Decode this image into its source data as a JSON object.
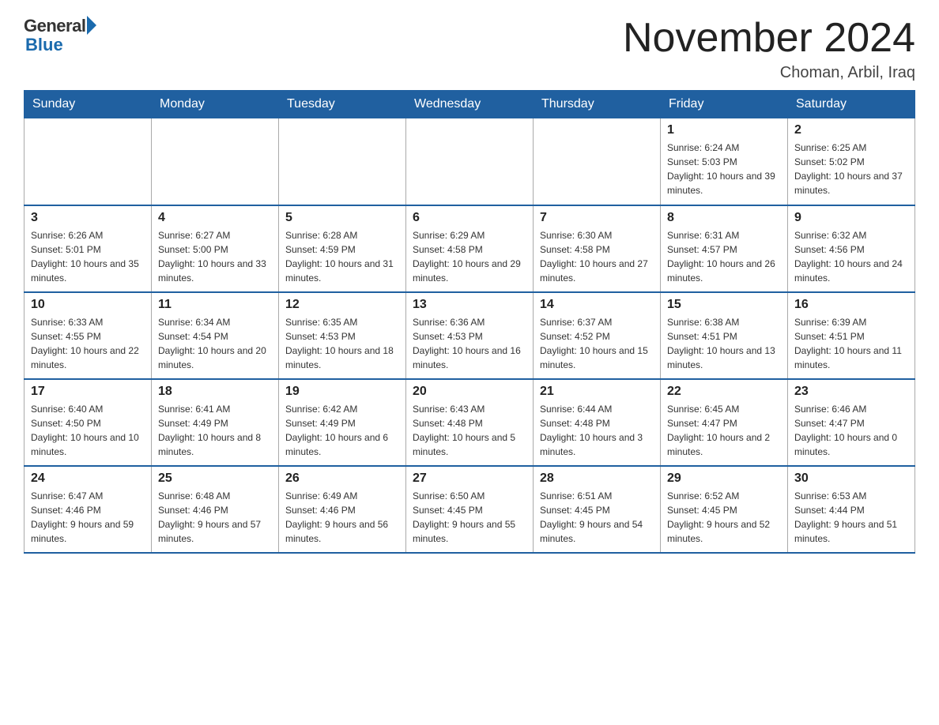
{
  "logo": {
    "general": "General",
    "blue": "Blue"
  },
  "title": {
    "month": "November 2024",
    "location": "Choman, Arbil, Iraq"
  },
  "days_of_week": [
    "Sunday",
    "Monday",
    "Tuesday",
    "Wednesday",
    "Thursday",
    "Friday",
    "Saturday"
  ],
  "weeks": [
    [
      {
        "day": "",
        "info": ""
      },
      {
        "day": "",
        "info": ""
      },
      {
        "day": "",
        "info": ""
      },
      {
        "day": "",
        "info": ""
      },
      {
        "day": "",
        "info": ""
      },
      {
        "day": "1",
        "info": "Sunrise: 6:24 AM\nSunset: 5:03 PM\nDaylight: 10 hours and 39 minutes."
      },
      {
        "day": "2",
        "info": "Sunrise: 6:25 AM\nSunset: 5:02 PM\nDaylight: 10 hours and 37 minutes."
      }
    ],
    [
      {
        "day": "3",
        "info": "Sunrise: 6:26 AM\nSunset: 5:01 PM\nDaylight: 10 hours and 35 minutes."
      },
      {
        "day": "4",
        "info": "Sunrise: 6:27 AM\nSunset: 5:00 PM\nDaylight: 10 hours and 33 minutes."
      },
      {
        "day": "5",
        "info": "Sunrise: 6:28 AM\nSunset: 4:59 PM\nDaylight: 10 hours and 31 minutes."
      },
      {
        "day": "6",
        "info": "Sunrise: 6:29 AM\nSunset: 4:58 PM\nDaylight: 10 hours and 29 minutes."
      },
      {
        "day": "7",
        "info": "Sunrise: 6:30 AM\nSunset: 4:58 PM\nDaylight: 10 hours and 27 minutes."
      },
      {
        "day": "8",
        "info": "Sunrise: 6:31 AM\nSunset: 4:57 PM\nDaylight: 10 hours and 26 minutes."
      },
      {
        "day": "9",
        "info": "Sunrise: 6:32 AM\nSunset: 4:56 PM\nDaylight: 10 hours and 24 minutes."
      }
    ],
    [
      {
        "day": "10",
        "info": "Sunrise: 6:33 AM\nSunset: 4:55 PM\nDaylight: 10 hours and 22 minutes."
      },
      {
        "day": "11",
        "info": "Sunrise: 6:34 AM\nSunset: 4:54 PM\nDaylight: 10 hours and 20 minutes."
      },
      {
        "day": "12",
        "info": "Sunrise: 6:35 AM\nSunset: 4:53 PM\nDaylight: 10 hours and 18 minutes."
      },
      {
        "day": "13",
        "info": "Sunrise: 6:36 AM\nSunset: 4:53 PM\nDaylight: 10 hours and 16 minutes."
      },
      {
        "day": "14",
        "info": "Sunrise: 6:37 AM\nSunset: 4:52 PM\nDaylight: 10 hours and 15 minutes."
      },
      {
        "day": "15",
        "info": "Sunrise: 6:38 AM\nSunset: 4:51 PM\nDaylight: 10 hours and 13 minutes."
      },
      {
        "day": "16",
        "info": "Sunrise: 6:39 AM\nSunset: 4:51 PM\nDaylight: 10 hours and 11 minutes."
      }
    ],
    [
      {
        "day": "17",
        "info": "Sunrise: 6:40 AM\nSunset: 4:50 PM\nDaylight: 10 hours and 10 minutes."
      },
      {
        "day": "18",
        "info": "Sunrise: 6:41 AM\nSunset: 4:49 PM\nDaylight: 10 hours and 8 minutes."
      },
      {
        "day": "19",
        "info": "Sunrise: 6:42 AM\nSunset: 4:49 PM\nDaylight: 10 hours and 6 minutes."
      },
      {
        "day": "20",
        "info": "Sunrise: 6:43 AM\nSunset: 4:48 PM\nDaylight: 10 hours and 5 minutes."
      },
      {
        "day": "21",
        "info": "Sunrise: 6:44 AM\nSunset: 4:48 PM\nDaylight: 10 hours and 3 minutes."
      },
      {
        "day": "22",
        "info": "Sunrise: 6:45 AM\nSunset: 4:47 PM\nDaylight: 10 hours and 2 minutes."
      },
      {
        "day": "23",
        "info": "Sunrise: 6:46 AM\nSunset: 4:47 PM\nDaylight: 10 hours and 0 minutes."
      }
    ],
    [
      {
        "day": "24",
        "info": "Sunrise: 6:47 AM\nSunset: 4:46 PM\nDaylight: 9 hours and 59 minutes."
      },
      {
        "day": "25",
        "info": "Sunrise: 6:48 AM\nSunset: 4:46 PM\nDaylight: 9 hours and 57 minutes."
      },
      {
        "day": "26",
        "info": "Sunrise: 6:49 AM\nSunset: 4:46 PM\nDaylight: 9 hours and 56 minutes."
      },
      {
        "day": "27",
        "info": "Sunrise: 6:50 AM\nSunset: 4:45 PM\nDaylight: 9 hours and 55 minutes."
      },
      {
        "day": "28",
        "info": "Sunrise: 6:51 AM\nSunset: 4:45 PM\nDaylight: 9 hours and 54 minutes."
      },
      {
        "day": "29",
        "info": "Sunrise: 6:52 AM\nSunset: 4:45 PM\nDaylight: 9 hours and 52 minutes."
      },
      {
        "day": "30",
        "info": "Sunrise: 6:53 AM\nSunset: 4:44 PM\nDaylight: 9 hours and 51 minutes."
      }
    ]
  ]
}
